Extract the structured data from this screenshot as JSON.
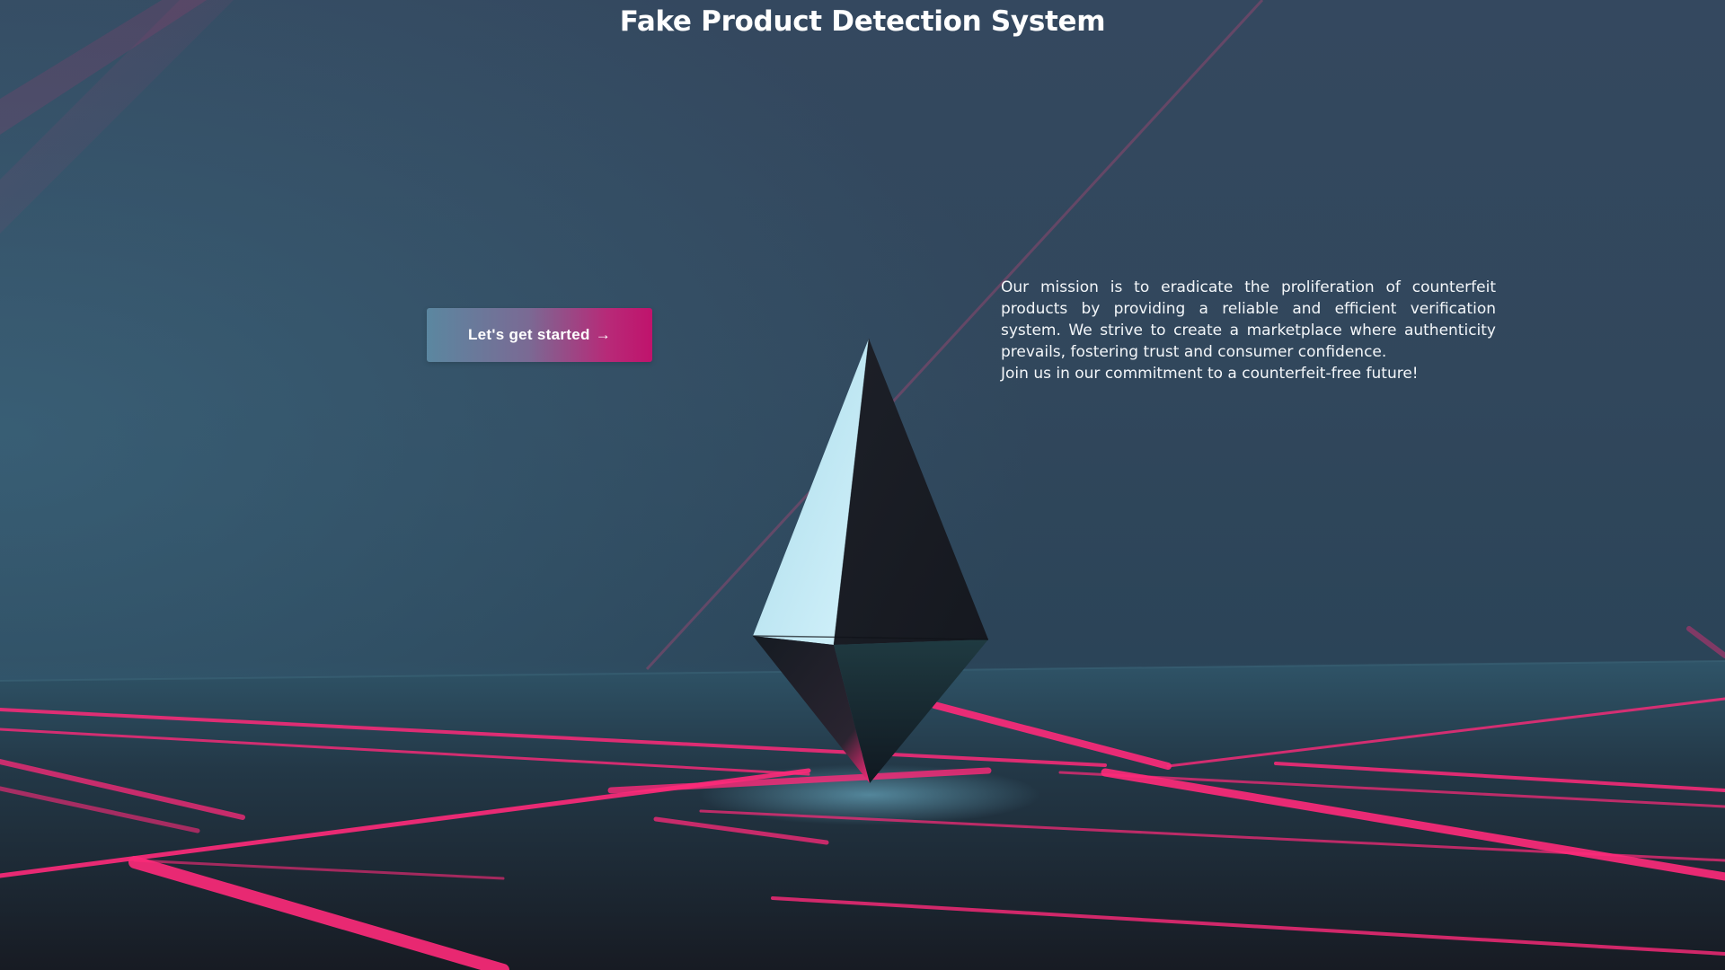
{
  "page": {
    "title": "Fake Product Detection System"
  },
  "hero": {
    "cta_label": "Let's get started",
    "cta_arrow": "→",
    "mission_text": "Our mission is to eradicate the proliferation of counterfeit products by providing a reliable and efficient verification system. We strive to create a marketplace where authenticity prevails, fostering trust and consumer confidence.",
    "mission_closing": "Join us in our commitment to a counterfeit-free future!"
  },
  "theme": {
    "background_top": "#34485f",
    "floor": "#2a4a5e",
    "accent_pink": "#ff2a7a",
    "button_gradient_start": "#5b87a0",
    "button_gradient_end": "#c0136c",
    "text": "#ffffff"
  },
  "icons": {
    "hero_artwork": "crystal-octahedron",
    "cta_arrow_icon": "right-arrow"
  }
}
